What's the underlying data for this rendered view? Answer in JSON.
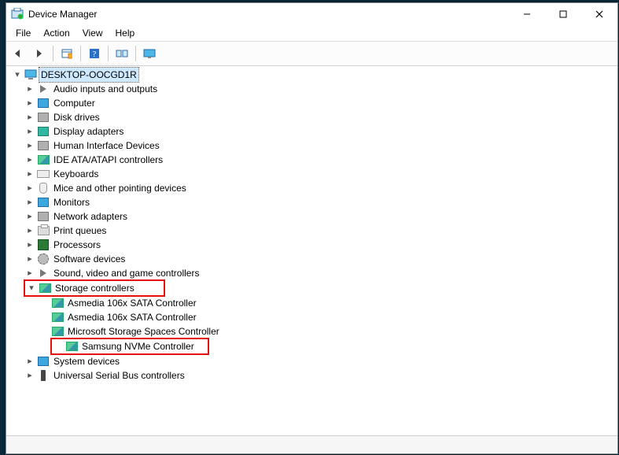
{
  "window": {
    "title": "Device Manager"
  },
  "menus": [
    "File",
    "Action",
    "View",
    "Help"
  ],
  "tree": {
    "root": "DESKTOP-OOCGD1R",
    "nodes": [
      {
        "label": "Audio inputs and outputs"
      },
      {
        "label": "Computer"
      },
      {
        "label": "Disk drives"
      },
      {
        "label": "Display adapters"
      },
      {
        "label": "Human Interface Devices"
      },
      {
        "label": "IDE ATA/ATAPI controllers"
      },
      {
        "label": "Keyboards"
      },
      {
        "label": "Mice and other pointing devices"
      },
      {
        "label": "Monitors"
      },
      {
        "label": "Network adapters"
      },
      {
        "label": "Print queues"
      },
      {
        "label": "Processors"
      },
      {
        "label": "Software devices"
      },
      {
        "label": "Sound, video and game controllers"
      },
      {
        "label": "Storage controllers",
        "expanded": true,
        "highlight": true,
        "children": [
          {
            "label": "Asmedia 106x SATA Controller"
          },
          {
            "label": "Asmedia 106x SATA Controller"
          },
          {
            "label": "Microsoft Storage Spaces Controller"
          },
          {
            "label": "Samsung NVMe Controller",
            "highlight": true
          }
        ]
      },
      {
        "label": "System devices"
      },
      {
        "label": "Universal Serial Bus controllers"
      }
    ]
  }
}
